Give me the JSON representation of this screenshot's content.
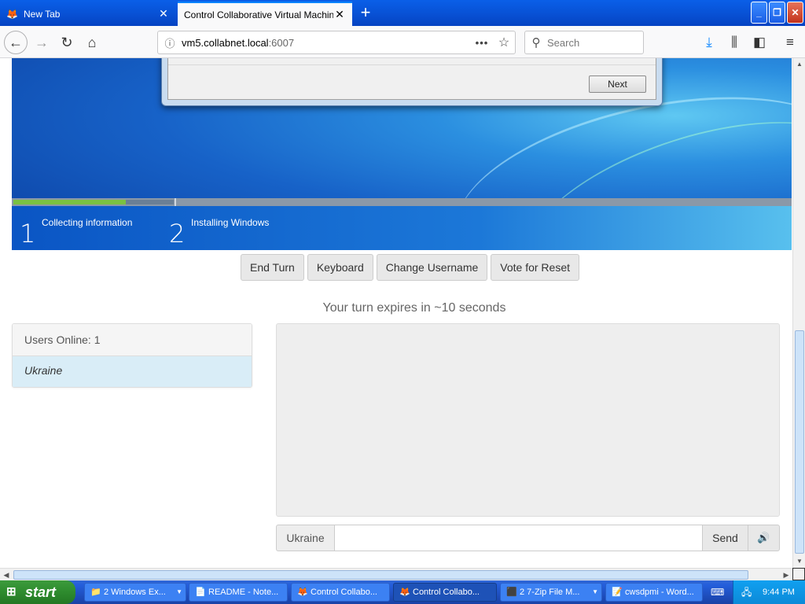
{
  "browser": {
    "tabs": [
      {
        "title": "New Tab",
        "icon": "firefox-icon",
        "active": false
      },
      {
        "title": "Control Collaborative Virtual Machines!",
        "icon": "",
        "active": true
      }
    ],
    "new_tab_symbol": "+",
    "close_symbol": "✕",
    "window_controls": {
      "minimize": "_",
      "restore": "❐",
      "close": "✕"
    },
    "url": {
      "host": "vm5.collabnet.local",
      "port": ":6007"
    },
    "search_placeholder": "Search",
    "icons": [
      "back-icon",
      "forward-icon",
      "reload-icon",
      "home-icon",
      "info-icon",
      "more-icon",
      "bookmark-star-icon",
      "search-icon",
      "download-icon",
      "library-icon",
      "sidebar-icon",
      "menu-icon"
    ]
  },
  "vm_screen": {
    "next_button": "Next",
    "progress_fraction": 0.7,
    "steps": [
      {
        "num": "1",
        "label": "Collecting information"
      },
      {
        "num": "2",
        "label": "Installing Windows"
      }
    ]
  },
  "controls": {
    "end_turn": "End Turn",
    "keyboard": "Keyboard",
    "change_username": "Change Username",
    "vote_reset": "Vote for Reset"
  },
  "turn_status": "Your turn expires in ~10 seconds",
  "users": {
    "header": "Users Online: 1",
    "list": [
      "Ukraine"
    ]
  },
  "chat": {
    "username": "Ukraine",
    "message_value": "",
    "send": "Send",
    "sound_icon": "speaker-icon"
  },
  "taskbar": {
    "start": "start",
    "tasks": [
      {
        "label": "2 Windows Ex...",
        "icon": "folder-icon",
        "active": false
      },
      {
        "label": "README - Note...",
        "icon": "notepad-icon",
        "active": false
      },
      {
        "label": "Control Collabo...",
        "icon": "firefox-icon",
        "active": false
      },
      {
        "label": "Control Collabo...",
        "icon": "firefox-icon",
        "active": true
      },
      {
        "label": "2 7-Zip File M...",
        "icon": "7zip-icon",
        "active": false
      },
      {
        "label": "cwsdpmi - Word...",
        "icon": "wordpad-icon",
        "active": false
      }
    ],
    "clock": "9:44 PM"
  },
  "colors": {
    "titlebar": "#0a5fe8",
    "vm_blue": "#1762c8",
    "progress_green": "#7ac142",
    "user_row": "#d9edf7",
    "start_green": "#3c9b3c"
  }
}
